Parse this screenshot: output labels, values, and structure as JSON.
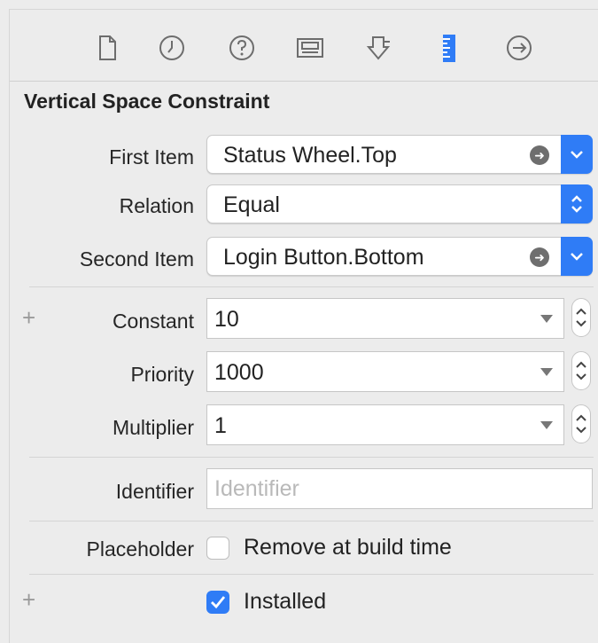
{
  "toolbar": {
    "icons": [
      "file-icon",
      "clock-icon",
      "help-icon",
      "identity-card-icon",
      "attributes-arrow-icon",
      "ruler-icon",
      "connections-arrow-icon"
    ],
    "accent": "#2f7cf6"
  },
  "section": {
    "title": "Vertical Space Constraint"
  },
  "fields": {
    "first_item": {
      "label": "First Item",
      "value": "Status Wheel.Top"
    },
    "relation": {
      "label": "Relation",
      "value": "Equal"
    },
    "second_item": {
      "label": "Second Item",
      "value": "Login Button.Bottom"
    },
    "constant": {
      "label": "Constant",
      "value": "10"
    },
    "priority": {
      "label": "Priority",
      "value": "1000"
    },
    "multiplier": {
      "label": "Multiplier",
      "value": "1"
    },
    "identifier": {
      "label": "Identifier",
      "value": "",
      "placeholder": "Identifier"
    },
    "placeholder": {
      "label": "Placeholder",
      "checkbox_label": "Remove at build time",
      "checked": false
    },
    "installed": {
      "checkbox_label": "Installed",
      "checked": true
    }
  },
  "plus_glyph": "+"
}
